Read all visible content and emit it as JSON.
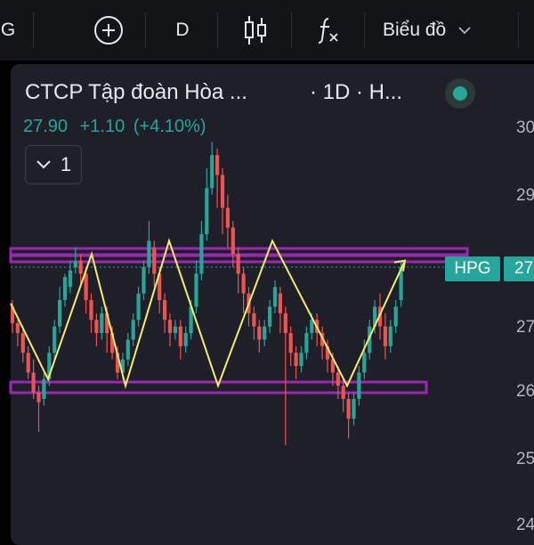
{
  "toolbar": {
    "symbol_fragment": "G",
    "interval": "D",
    "chart_menu_label": "Biểu đồ"
  },
  "legend": {
    "title": "CTCP Tập đoàn Hòa ...",
    "interval_suffix": "· 1D · H...",
    "price": "27.90",
    "change": "+1.10",
    "change_pct": "(+4.10%)",
    "collapsed_count": "1"
  },
  "price_tag": {
    "symbol": "HPG",
    "value": "27"
  },
  "axis_labels": [
    "30",
    "29",
    "27",
    "26",
    "25",
    "24"
  ],
  "colors": {
    "up": "#26a69a",
    "down": "#ef5350",
    "zigzag": "#f5ee6b",
    "zones": "#9c27b0",
    "background": "#1e1f29"
  },
  "chart_data": {
    "type": "candlestick",
    "y_axis_ticks": [
      30,
      29,
      27,
      26,
      25,
      24
    ],
    "last_price": 27.9,
    "zones": [
      {
        "low": 28.3,
        "high": 28.5
      },
      {
        "low": 26.0,
        "high": 26.15
      }
    ],
    "zigzag_points": [
      27.35,
      26.2,
      28.1,
      26.1,
      28.3,
      26.1,
      28.3,
      26.1,
      28.0
    ],
    "candles": [
      [
        27.3,
        27.05,
        26.9,
        27.4
      ],
      [
        27.05,
        26.9,
        26.7,
        27.1
      ],
      [
        26.9,
        26.6,
        26.45,
        27.0
      ],
      [
        26.6,
        26.3,
        26.2,
        26.7
      ],
      [
        26.3,
        26.0,
        25.9,
        26.5
      ],
      [
        26.0,
        25.85,
        25.4,
        26.1
      ],
      [
        25.9,
        26.2,
        25.8,
        26.3
      ],
      [
        26.2,
        26.6,
        26.1,
        26.7
      ],
      [
        26.6,
        27.0,
        26.5,
        27.1
      ],
      [
        27.0,
        27.4,
        26.9,
        27.6
      ],
      [
        27.4,
        27.75,
        27.3,
        27.8
      ],
      [
        27.6,
        27.85,
        27.5,
        28.0
      ],
      [
        27.9,
        28.0,
        27.8,
        28.2
      ],
      [
        28.0,
        27.8,
        27.6,
        28.1
      ],
      [
        27.8,
        27.4,
        27.2,
        27.9
      ],
      [
        27.4,
        27.1,
        26.9,
        27.5
      ],
      [
        27.1,
        26.9,
        26.7,
        27.2
      ],
      [
        26.9,
        27.2,
        26.8,
        27.3
      ],
      [
        27.2,
        26.9,
        26.6,
        27.3
      ],
      [
        26.9,
        26.6,
        26.5,
        27.0
      ],
      [
        26.6,
        26.3,
        26.2,
        26.7
      ],
      [
        26.3,
        26.5,
        26.2,
        26.6
      ],
      [
        26.5,
        26.8,
        26.4,
        26.9
      ],
      [
        26.8,
        27.1,
        26.7,
        27.2
      ],
      [
        27.1,
        27.5,
        27.0,
        27.6
      ],
      [
        27.5,
        27.9,
        27.4,
        28.0
      ],
      [
        27.9,
        28.3,
        27.8,
        28.6
      ],
      [
        28.2,
        27.8,
        27.6,
        28.3
      ],
      [
        27.8,
        27.4,
        27.2,
        27.9
      ],
      [
        27.4,
        27.1,
        26.9,
        27.5
      ],
      [
        27.1,
        26.9,
        26.7,
        27.2
      ],
      [
        26.9,
        27.0,
        26.8,
        27.1
      ],
      [
        27.0,
        26.7,
        26.5,
        27.1
      ],
      [
        26.7,
        26.9,
        26.6,
        27.0
      ],
      [
        26.9,
        27.3,
        26.8,
        27.4
      ],
      [
        27.3,
        27.8,
        27.2,
        28.0
      ],
      [
        27.8,
        28.4,
        27.7,
        28.6
      ],
      [
        28.4,
        29.1,
        28.3,
        29.4
      ],
      [
        29.1,
        29.6,
        29.0,
        29.8
      ],
      [
        29.6,
        29.3,
        28.8,
        29.7
      ],
      [
        29.3,
        28.8,
        28.4,
        29.4
      ],
      [
        28.8,
        28.5,
        28.2,
        29.0
      ],
      [
        28.5,
        28.1,
        27.9,
        28.6
      ],
      [
        28.1,
        27.8,
        27.5,
        28.2
      ],
      [
        27.8,
        27.5,
        27.2,
        27.9
      ],
      [
        27.5,
        27.2,
        27.0,
        27.6
      ],
      [
        27.2,
        27.0,
        26.8,
        27.3
      ],
      [
        27.0,
        26.8,
        26.6,
        27.1
      ],
      [
        26.8,
        27.0,
        26.7,
        27.1
      ],
      [
        27.0,
        27.3,
        26.9,
        27.4
      ],
      [
        27.3,
        27.6,
        27.2,
        27.7
      ],
      [
        27.5,
        27.2,
        26.9,
        27.6
      ],
      [
        27.2,
        26.9,
        25.2,
        27.3
      ],
      [
        26.9,
        26.6,
        26.4,
        27.0
      ],
      [
        26.6,
        26.4,
        26.2,
        26.7
      ],
      [
        26.4,
        26.6,
        26.3,
        26.7
      ],
      [
        26.6,
        26.9,
        26.5,
        27.0
      ],
      [
        26.9,
        27.1,
        26.8,
        27.2
      ],
      [
        27.1,
        26.9,
        26.7,
        27.2
      ],
      [
        26.9,
        26.7,
        26.5,
        27.0
      ],
      [
        26.7,
        26.5,
        26.3,
        26.8
      ],
      [
        26.5,
        26.3,
        26.1,
        26.6
      ],
      [
        26.3,
        26.1,
        25.9,
        26.4
      ],
      [
        26.1,
        25.9,
        25.7,
        26.2
      ],
      [
        25.9,
        25.6,
        25.3,
        26.0
      ],
      [
        25.6,
        25.9,
        25.5,
        26.0
      ],
      [
        25.9,
        26.3,
        25.8,
        26.4
      ],
      [
        26.3,
        26.6,
        26.2,
        26.8
      ],
      [
        26.6,
        27.0,
        26.5,
        27.1
      ],
      [
        27.0,
        27.3,
        26.9,
        27.4
      ],
      [
        27.3,
        27.0,
        26.8,
        27.5
      ],
      [
        27.0,
        26.7,
        26.5,
        27.2
      ],
      [
        26.7,
        27.0,
        26.6,
        27.1
      ],
      [
        27.0,
        27.3,
        26.9,
        27.4
      ],
      [
        27.4,
        27.9,
        27.3,
        28.0
      ]
    ]
  }
}
